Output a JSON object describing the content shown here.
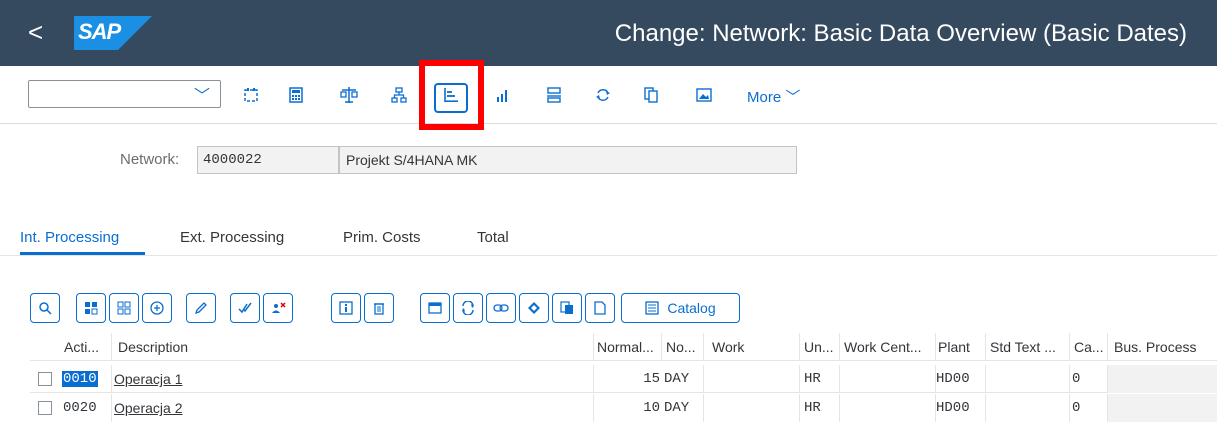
{
  "header": {
    "back_glyph": "<",
    "logo_text": "SAP",
    "title": "Change: Network: Basic Data Overview (Basic Dates)",
    "bg_color": "#354a5f"
  },
  "toolbar": {
    "dropdown_value": "",
    "icons": [
      "calendar-icon",
      "calculator-icon",
      "balance-icon",
      "hierarchy-icon",
      "gantt-icon",
      "bar-chart-icon",
      "print-layout-icon",
      "cycle-icon",
      "copy-icon",
      "image-icon"
    ],
    "more_label": "More",
    "highlighted_icon": "gantt-icon"
  },
  "network": {
    "label": "Network:",
    "number": "4000022",
    "description": "Projekt S/4HANA MK"
  },
  "tabs": [
    {
      "label": "Int. Processing",
      "active": true
    },
    {
      "label": "Ext. Processing",
      "active": false
    },
    {
      "label": "Prim. Costs",
      "active": false
    },
    {
      "label": "Total",
      "active": false
    }
  ],
  "table_toolbar": {
    "catalog_label": "Catalog"
  },
  "table": {
    "columns": [
      "Acti...",
      "Description",
      "Normal...",
      "No...",
      "Work",
      "Un...",
      "Work Cent...",
      "Plant",
      "Std Text ...",
      "Ca...",
      "Bus. Process"
    ],
    "rows": [
      {
        "activity": "0010",
        "description": "Operacja 1",
        "normal": "15",
        "unit": "DAY",
        "work": "",
        "work_unit": "HR",
        "work_center": "",
        "plant": "HD00",
        "std_text": "",
        "calc": "0",
        "bus_process": ""
      },
      {
        "activity": "0020",
        "description": "Operacja 2",
        "normal": "10",
        "unit": "DAY",
        "work": "",
        "work_unit": "HR",
        "work_center": "",
        "plant": "HD00",
        "std_text": "",
        "calc": "0",
        "bus_process": ""
      }
    ]
  },
  "colors": {
    "accent": "#0a6ed1",
    "highlight_box": "#ff0000"
  }
}
